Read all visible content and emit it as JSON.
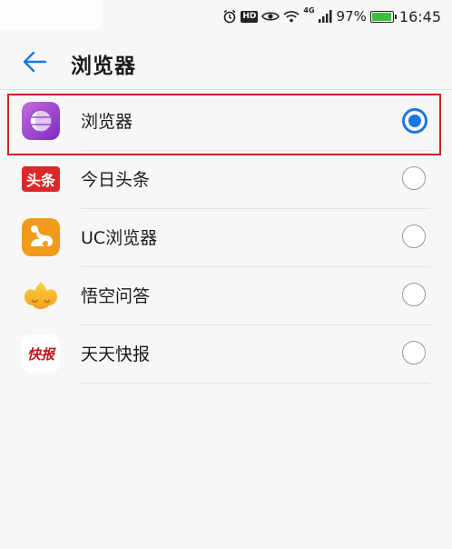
{
  "status_bar": {
    "network": "4G",
    "battery_percent": "97%",
    "battery_level": 0.97,
    "time": "16:45",
    "icons": [
      "alarm-icon",
      "hd-icon",
      "eye-comfort-icon",
      "wifi-icon",
      "signal-icon",
      "battery-icon"
    ]
  },
  "header": {
    "title": "浏览器",
    "back_icon": "back-arrow-icon",
    "accent_color": "#1a77e0"
  },
  "apps": [
    {
      "label": "浏览器",
      "icon": "huawei-browser-icon",
      "selected": true
    },
    {
      "label": "今日头条",
      "icon": "toutiao-icon",
      "icon_text": "头条",
      "selected": false
    },
    {
      "label": "UC浏览器",
      "icon": "uc-browser-icon",
      "selected": false
    },
    {
      "label": "悟空问答",
      "icon": "wukong-icon",
      "selected": false
    },
    {
      "label": "天天快报",
      "icon": "kuaibao-icon",
      "icon_text": "快报",
      "selected": false
    }
  ],
  "highlight_color": "#d42222"
}
